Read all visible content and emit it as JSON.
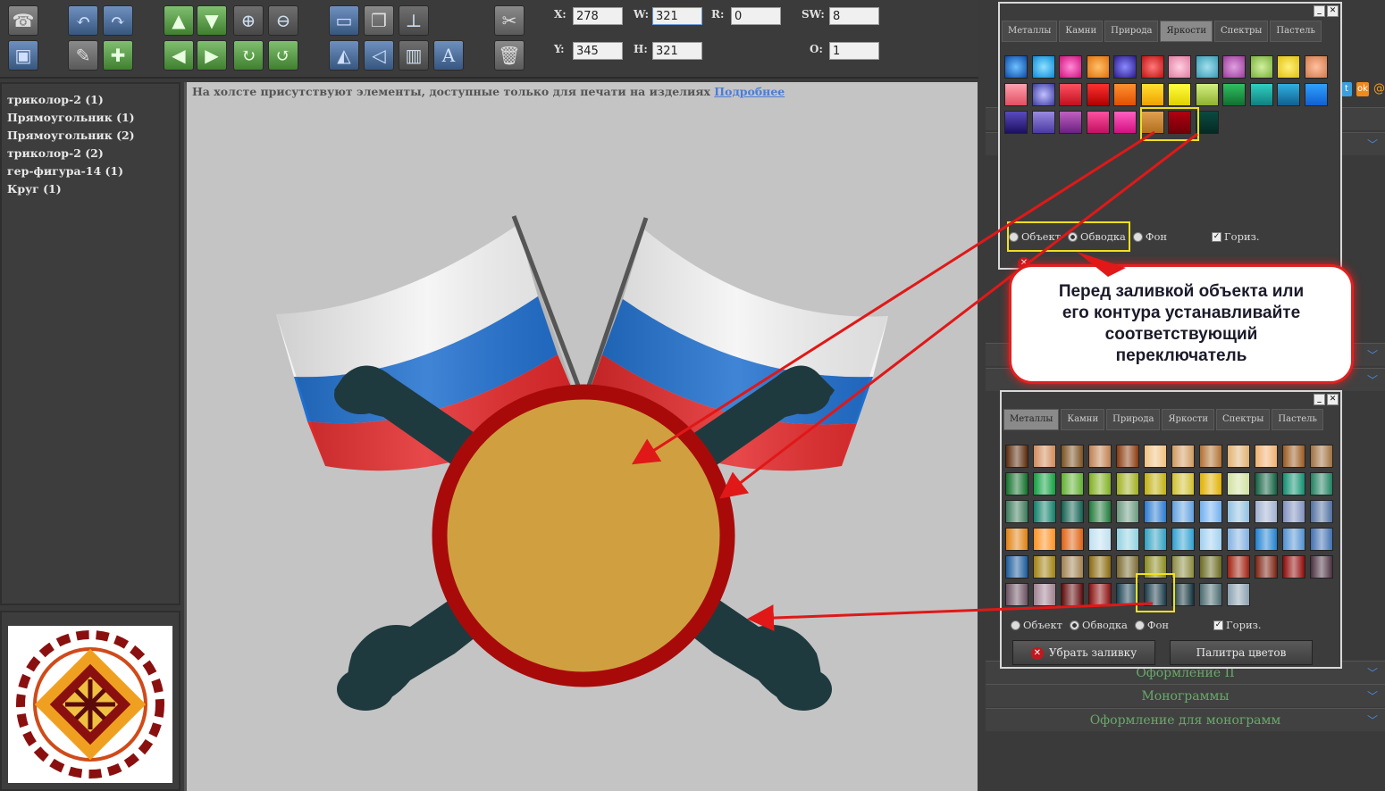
{
  "fields": {
    "x_label": "X:",
    "x_value": "278",
    "w_label": "W:",
    "w_value": "321",
    "r_label": "R:",
    "r_value": "0",
    "sw_label": "SW:",
    "sw_value": "8",
    "y_label": "Y:",
    "y_value": "345",
    "h_label": "H:",
    "h_value": "321",
    "o_label": "O:",
    "o_value": "1"
  },
  "layers": [
    "триколор-2 (1)",
    "Прямоугольник (1)",
    "Прямоугольник (2)",
    "триколор-2 (2)",
    "гер-фигура-14 (1)",
    "Круг (1)"
  ],
  "canvas": {
    "notice": "На холсте присутствуют элементы, доступные только для печати на изделиях",
    "notice_link": "Подробнее"
  },
  "palette_top": {
    "tabs": [
      "Металлы",
      "Камни",
      "Природа",
      "Яркости",
      "Спектры",
      "Пастель"
    ],
    "active_tab": "Яркости",
    "radio_object": "Объект",
    "radio_stroke": "Обводка",
    "radio_bg": "Фон",
    "check_horiz": "Гориз."
  },
  "palette_bottom": {
    "tabs": [
      "Металлы",
      "Камни",
      "Природа",
      "Яркости",
      "Спектры",
      "Пастель"
    ],
    "active_tab": "Металлы",
    "radio_object": "Объект",
    "radio_stroke": "Обводка",
    "radio_bg": "Фон",
    "check_horiz": "Гориз.",
    "remove_fill": "Убрать заливку",
    "color_palette": "Палитра цветов"
  },
  "callout": {
    "line1": "Перед заливкой объекта или",
    "line2": "его контура устанавливайте",
    "line3": "соответствующий",
    "line4": "переключатель"
  },
  "accordion": {
    "decor2": "Оформление II",
    "monograms": "Монограммы",
    "monogram_decor": "Оформление для монограмм"
  },
  "colors": {
    "circle_fill": "#d0a040",
    "circle_stroke": "#a80a0a",
    "cannon": "#1f3a3e",
    "canvas_bg": "#c4c4c4",
    "arrow": "#e01818",
    "highlight": "#f0e020"
  },
  "icons": {
    "toolbar_row1": [
      "phone-icon",
      "undo-icon",
      "redo-icon",
      "arrow-up-icon",
      "arrow-down-icon",
      "zoom-in-icon",
      "zoom-out-icon",
      "send-back-icon",
      "bring-front-icon",
      "align-icon",
      "tools-icon"
    ],
    "toolbar_row2": [
      "save-icon",
      "palette-icon",
      "add-image-icon",
      "arrow-left-icon",
      "arrow-right-icon",
      "rotate-cw-icon",
      "rotate-ccw-icon",
      "flip-v-icon",
      "flip-h-icon",
      "distribute-icon",
      "text-effect-icon",
      "trash-icon"
    ]
  }
}
